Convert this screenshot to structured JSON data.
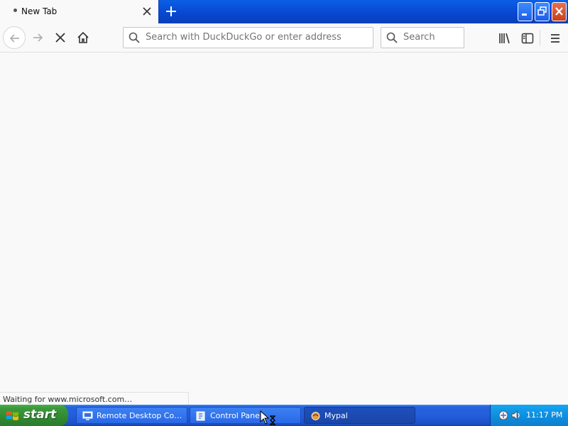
{
  "tab": {
    "title": "New Tab"
  },
  "nav": {
    "url_placeholder": "Search with DuckDuckGo or enter address",
    "search_placeholder": "Search"
  },
  "status": {
    "text": "Waiting for www.microsoft.com…"
  },
  "taskbar": {
    "start_label": "start",
    "tasks": [
      {
        "label": "Remote Desktop Con…",
        "icon": "remote-desktop-icon"
      },
      {
        "label": "Control Panel",
        "icon": "control-panel-icon"
      },
      {
        "label": "Mypal",
        "icon": "mypal-icon"
      }
    ],
    "clock": "11:17 PM"
  },
  "colors": {
    "taskbar": "#245edb",
    "start": "#318a31",
    "tray": "#0f8fe0",
    "content_bg": "#f9f9fa"
  }
}
